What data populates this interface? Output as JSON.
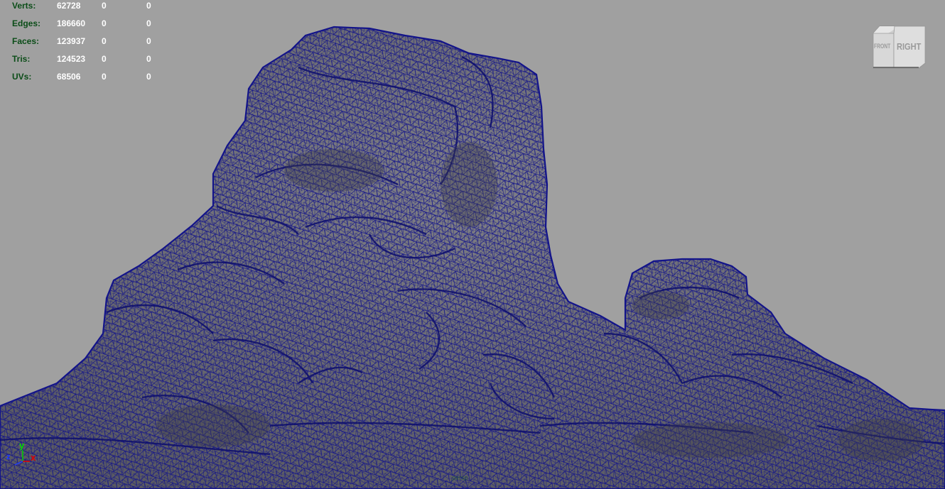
{
  "hud": {
    "rows": [
      {
        "label": "Verts:",
        "c1": "62728",
        "c2": "0",
        "c3": "0"
      },
      {
        "label": "Edges:",
        "c1": "186660",
        "c2": "0",
        "c3": "0"
      },
      {
        "label": "Faces:",
        "c1": "123937",
        "c2": "0",
        "c3": "0"
      },
      {
        "label": "Tris:",
        "c1": "124523",
        "c2": "0",
        "c3": "0"
      },
      {
        "label": "UVs:",
        "c1": "68506",
        "c2": "0",
        "c3": "0"
      }
    ]
  },
  "viewcube": {
    "front": "FRONT",
    "right": "RIGHT"
  },
  "axis": {
    "x": "x",
    "y": "y",
    "z": "z"
  },
  "camera": {
    "label": "persp"
  },
  "colors": {
    "background": "#a0a0a0",
    "wire": "#13148a",
    "rock_fill": "#6e6e74",
    "hud_label": "#0b4d18",
    "hud_value": "#ffffff"
  }
}
